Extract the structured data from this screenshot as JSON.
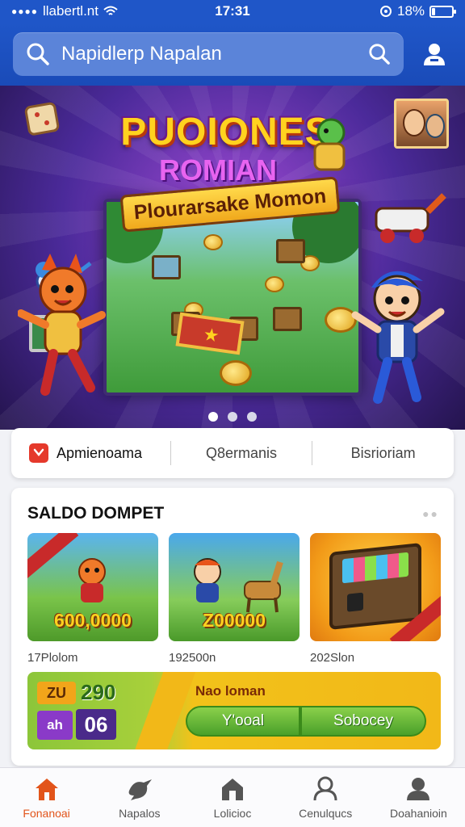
{
  "status_bar": {
    "carrier": "llabertl.nt",
    "time": "17:31",
    "battery": "18%",
    "battery_level": 0.18
  },
  "header": {
    "search_text": "Napidlerp Napalan"
  },
  "banner": {
    "title": "PUOIONES",
    "subtitle": "ROMIAN",
    "tagline": "Plourarsake Momon",
    "active_slide": 0,
    "slide_count": 3
  },
  "tabs": [
    {
      "label": "Apmienoama",
      "active": true
    },
    {
      "label": "Q8ermanis",
      "active": false
    },
    {
      "label": "Bisrioriam",
      "active": false
    }
  ],
  "wallet": {
    "title": "SALDO DOMPET",
    "cards": [
      {
        "value": "600,0000",
        "caption": "17Plolom"
      },
      {
        "value": "Z00000",
        "caption": "192500n"
      },
      {
        "value": "",
        "caption": "202Slon"
      }
    ],
    "bonus": {
      "badge_1": "ZU",
      "number_1": "290",
      "badge_2": "ah",
      "number_2": "06",
      "label": "Nao loman",
      "button_left": "Y'ooal",
      "button_right": "Sobocey"
    }
  },
  "bottom_nav": [
    {
      "label": "Fonanoai",
      "icon": "home-icon",
      "active": true
    },
    {
      "label": "Napalos",
      "icon": "bird-icon",
      "active": false
    },
    {
      "label": "Lolicioc",
      "icon": "house-icon",
      "active": false
    },
    {
      "label": "Cenulqucs",
      "icon": "user-icon",
      "active": false
    },
    {
      "label": "Doahanioin",
      "icon": "profile-icon",
      "active": false
    }
  ],
  "colors": {
    "primary": "#1f56c8",
    "accent": "#e2541a",
    "tab_icon": "#e5392b"
  }
}
